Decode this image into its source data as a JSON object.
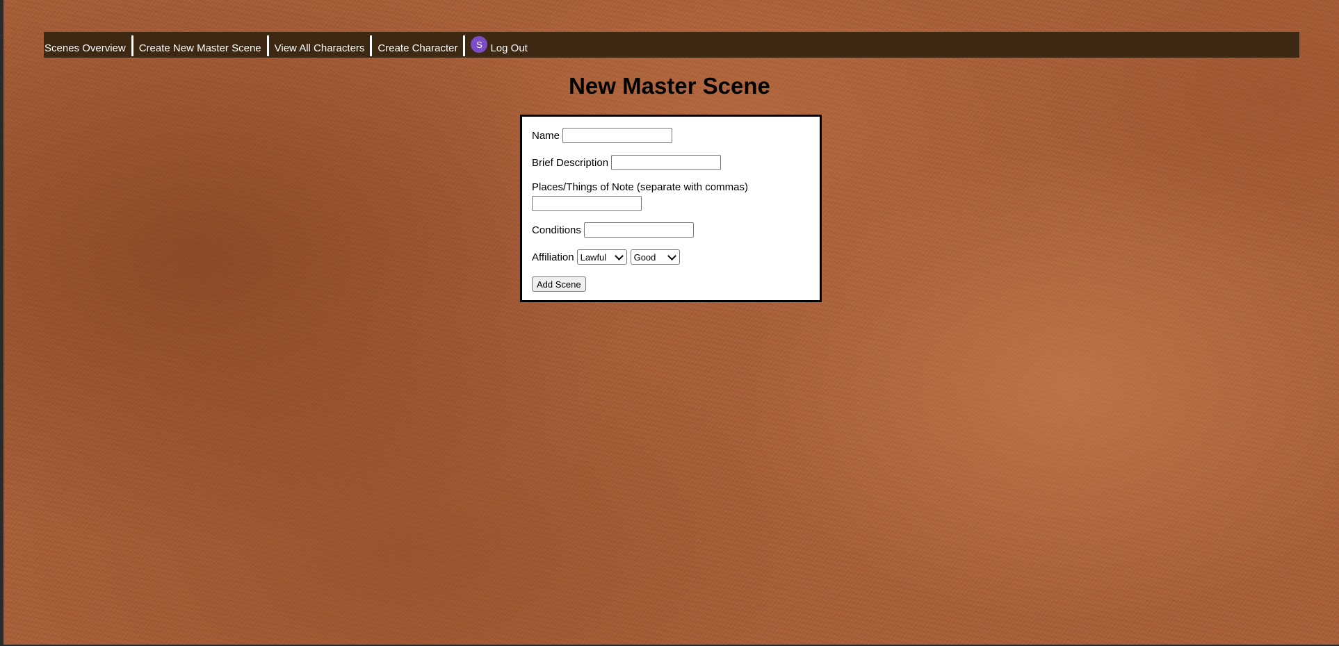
{
  "nav": {
    "items": [
      {
        "label": "Scenes Overview"
      },
      {
        "label": "Create New Master Scene"
      },
      {
        "label": "View All Characters"
      },
      {
        "label": "Create Character"
      }
    ],
    "avatar_initial": "S",
    "logout_label": "Log Out"
  },
  "page": {
    "title": "New Master Scene"
  },
  "form": {
    "name_label": "Name",
    "name_value": "",
    "brief_description_label": "Brief Description",
    "brief_description_value": "",
    "places_label": "Places/Things of Note (separate with commas)",
    "places_value": "",
    "conditions_label": "Conditions",
    "conditions_value": "",
    "affiliation_label": "Affiliation",
    "affiliation_law_selected": "Lawful",
    "affiliation_moral_selected": "Good",
    "submit_label": "Add Scene"
  },
  "colors": {
    "navbar_bg": "#342410",
    "avatar_bg": "#7d4cc9",
    "background": "#a9603a"
  }
}
